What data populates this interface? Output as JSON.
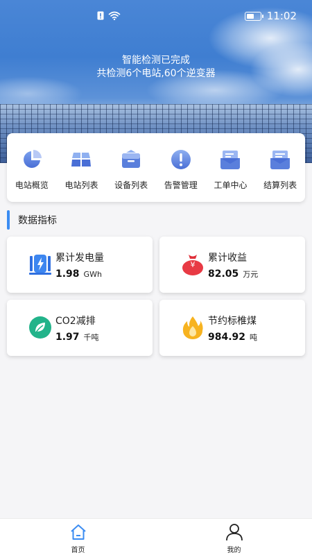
{
  "status_bar": {
    "time": "11:02"
  },
  "header": {
    "line1": "智能检测已完成",
    "line2": "共检测6个电站,60个逆变器"
  },
  "menu": {
    "items": [
      {
        "label": "电站概览",
        "icon": "pie-chart-icon"
      },
      {
        "label": "电站列表",
        "icon": "grid-panels-icon"
      },
      {
        "label": "设备列表",
        "icon": "briefcase-icon"
      },
      {
        "label": "告警管理",
        "icon": "alert-icon"
      },
      {
        "label": "工单中心",
        "icon": "inbox-doc-icon"
      },
      {
        "label": "结算列表",
        "icon": "inbox-list-icon"
      }
    ]
  },
  "section": {
    "title": "数据指标"
  },
  "metrics": [
    {
      "label": "累计发电量",
      "value": "1.98",
      "unit": "GWh",
      "icon": "generator-icon"
    },
    {
      "label": "累计收益",
      "value": "82.05",
      "unit": "万元",
      "icon": "money-bag-icon"
    },
    {
      "label": "CO2减排",
      "value": "1.97",
      "unit": "千吨",
      "icon": "leaf-icon"
    },
    {
      "label": "节约标椎煤",
      "value": "984.92",
      "unit": "吨",
      "icon": "flame-icon"
    }
  ],
  "bottom_nav": {
    "items": [
      {
        "label": "首页",
        "icon": "home-icon",
        "active": true
      },
      {
        "label": "我的",
        "icon": "user-icon",
        "active": false
      }
    ]
  },
  "colors": {
    "accent": "#3b8cf2",
    "icon_blue": "#5a83e0"
  }
}
